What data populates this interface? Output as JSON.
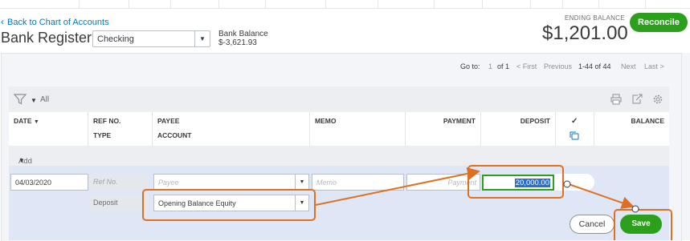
{
  "header": {
    "back_link": "Back to Chart of Accounts",
    "title": "Bank Register",
    "account_select": "Checking",
    "bank_balance_label": "Bank Balance",
    "bank_balance_value": "$-3,621.93",
    "ending_balance_label": "ENDING BALANCE",
    "ending_balance_value": "$1,201.00",
    "reconcile_label": "Reconcile"
  },
  "pager": {
    "goto_label": "Go to:",
    "page": "1",
    "of_pages": "of 1",
    "first": "< First",
    "previous": "Previous",
    "range": "1-44 of 44",
    "next": "Next",
    "last": "Last >"
  },
  "toolbar": {
    "filter_label": "All",
    "icons": [
      "filter-icon",
      "print-icon",
      "export-icon",
      "settings-icon"
    ]
  },
  "columns": {
    "date": "DATE",
    "ref_no": "REF NO.",
    "type": "TYPE",
    "payee": "PAYEE",
    "account": "ACCOUNT",
    "memo": "MEMO",
    "payment": "PAYMENT",
    "deposit": "DEPOSIT",
    "check": "✓",
    "balance": "BALANCE"
  },
  "add_deposit": "Add deposit",
  "edit_row": {
    "date": "04/03/2020",
    "ref_placeholder": "Ref No.",
    "type": "Deposit",
    "payee_placeholder": "Payee",
    "account": "Opening Balance Equity",
    "memo_placeholder": "Memo",
    "payment_placeholder": "Payment",
    "deposit_value": "20,000.00"
  },
  "actions": {
    "cancel": "Cancel",
    "save": "Save"
  },
  "colors": {
    "accent_green": "#2ca01c",
    "link_blue": "#0077c5",
    "annotation_orange": "#e07021"
  }
}
